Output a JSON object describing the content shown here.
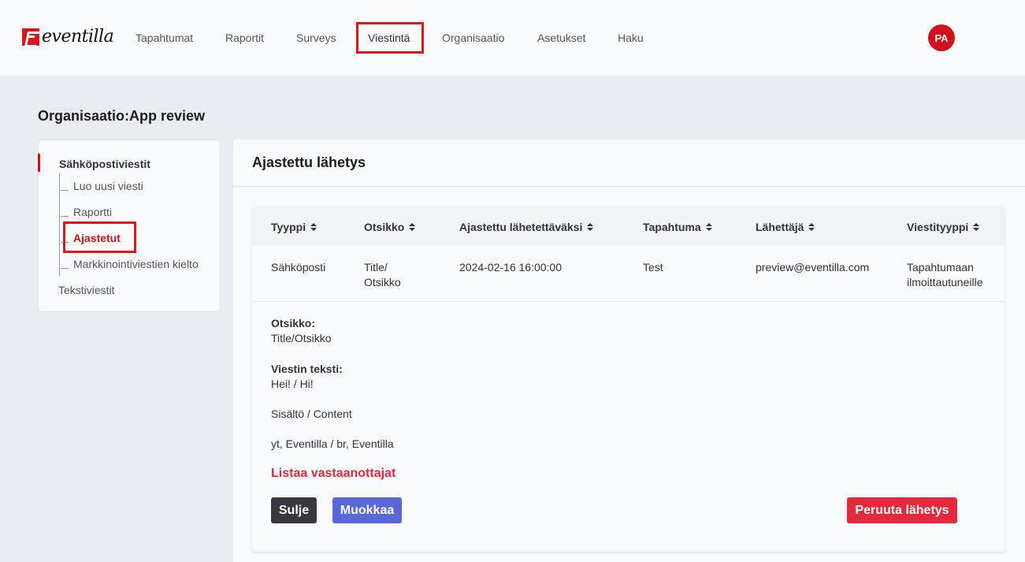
{
  "brand": {
    "logo_text": "eventilla"
  },
  "nav": {
    "items": [
      {
        "label": "Tapahtumat"
      },
      {
        "label": "Raportit"
      },
      {
        "label": "Surveys"
      },
      {
        "label": "Viestintä"
      },
      {
        "label": "Organisaatio"
      },
      {
        "label": "Asetukset"
      },
      {
        "label": "Haku"
      }
    ],
    "active": "Viestintä",
    "avatar_initials": "PA"
  },
  "page": {
    "org_title": "Organisaatio:App review"
  },
  "sidebar": {
    "section": "Sähköpostiviestit",
    "children": [
      {
        "label": "Luo uusi viesti"
      },
      {
        "label": "Raportti"
      },
      {
        "label": "Ajastetut"
      },
      {
        "label": "Markkinointiviestien kielto"
      }
    ],
    "active_child": "Ajastetut",
    "other_section": "Tekstiviestit"
  },
  "panel": {
    "title": "Ajastettu lähetys",
    "table": {
      "columns": [
        "Tyyppi",
        "Otsikko",
        "Ajastettu lähetettäväksi",
        "Tapahtuma",
        "Lähettäjä",
        "Viestityyppi"
      ],
      "row": {
        "type": "Sähköposti",
        "title_line1": "Title/",
        "title_line2": "Otsikko",
        "scheduled": "2024-02-16 16:00:00",
        "event": "Test",
        "sender": "preview@eventilla.com",
        "msg_type_line1": "Tapahtumaan",
        "msg_type_line2": "ilmoittautuneille"
      }
    },
    "detail": {
      "subject_label": "Otsikko:",
      "subject_value": "Title/Otsikko",
      "body_label": "Viestin teksti:",
      "body_lines": [
        "Hei! / Hi!",
        "Sisältö / Content",
        "yt, Eventilla / br, Eventilla"
      ]
    },
    "list_recipients_label": "Listaa vastaanottajat",
    "buttons": {
      "close": "Sulje",
      "edit": "Muokkaa",
      "cancel_send": "Peruuta lähetys"
    }
  },
  "colors": {
    "brand_red": "#d0111b",
    "link_red": "#e0293f",
    "edit_blue": "#5a67d8",
    "dark": "#343a40"
  }
}
